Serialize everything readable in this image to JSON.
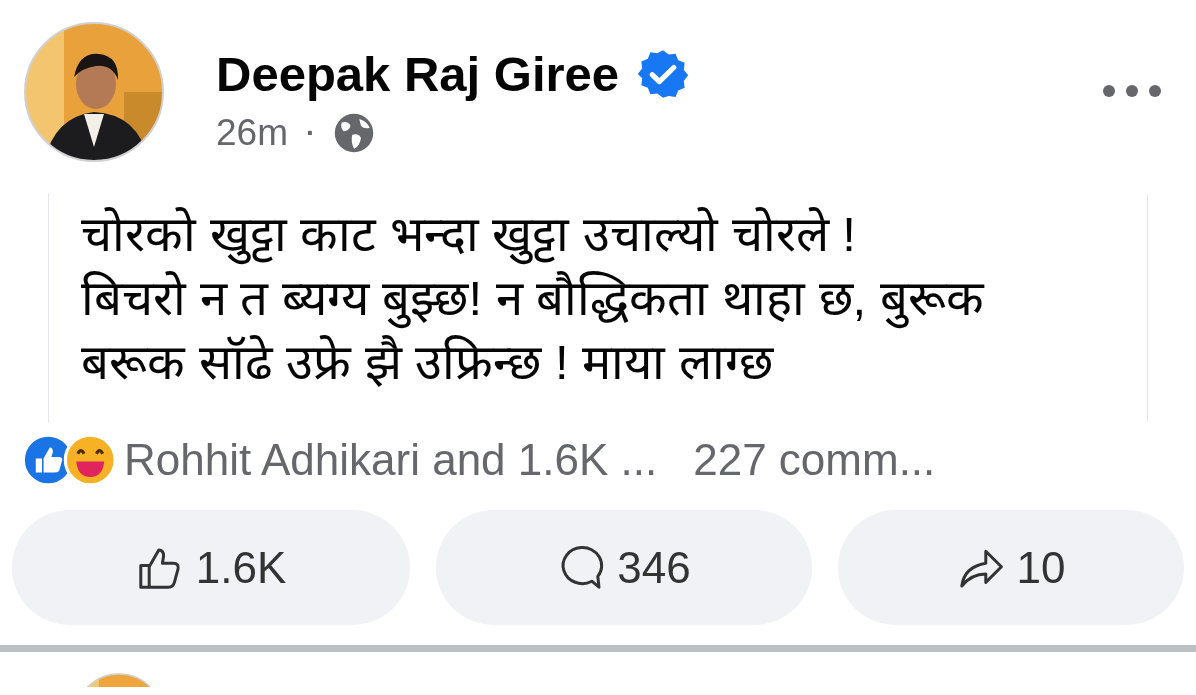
{
  "post": {
    "author": "Deepak Raj Giree",
    "verified": true,
    "time": "26m",
    "separator": "·",
    "public": true,
    "text": [
      "चोरको खुट्टा काट भन्दा खुट्टा उचाल्यो चोरले !",
      "बिचरो न त ब्यग्य बुझ्छ! न बौद्धिकता थाहा छ, बुरूक",
      "बरूक सॉढे उफ्रे झै उफ्रिन्छ ! माया लाग्छ"
    ],
    "reactions": {
      "summary": "Rohhit Adhikari and 1.6K ...",
      "comments": "227 comm..."
    },
    "actions": [
      {
        "kind": "like",
        "count": "1.6K"
      },
      {
        "kind": "comment",
        "count": "346"
      },
      {
        "kind": "share",
        "count": "10"
      }
    ]
  }
}
